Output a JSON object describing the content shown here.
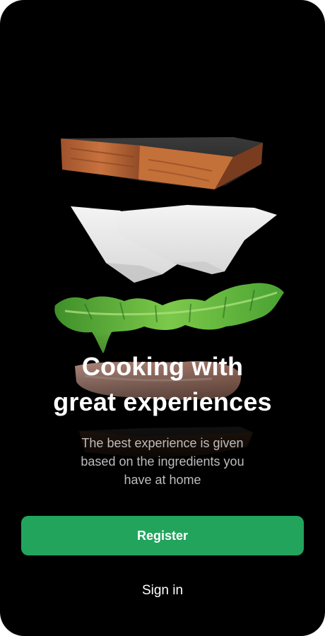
{
  "onboarding": {
    "headline_line1": "Cooking with",
    "headline_line2": "great experiences",
    "subtitle_line1": "The best experience is given",
    "subtitle_line2": "based on the ingredients you",
    "subtitle_line3": "have at home",
    "register_label": "Register",
    "signin_label": "Sign in"
  },
  "colors": {
    "background": "#000000",
    "accent": "#22a45d",
    "text_primary": "#ffffff",
    "text_secondary": "#bdbdbd"
  },
  "hero_image": {
    "subject": "floating-sandwich-layers",
    "layers": [
      "toast-slice",
      "cheese-slice",
      "lettuce-leaf",
      "ham-slice",
      "bottom-toast-slice"
    ]
  }
}
